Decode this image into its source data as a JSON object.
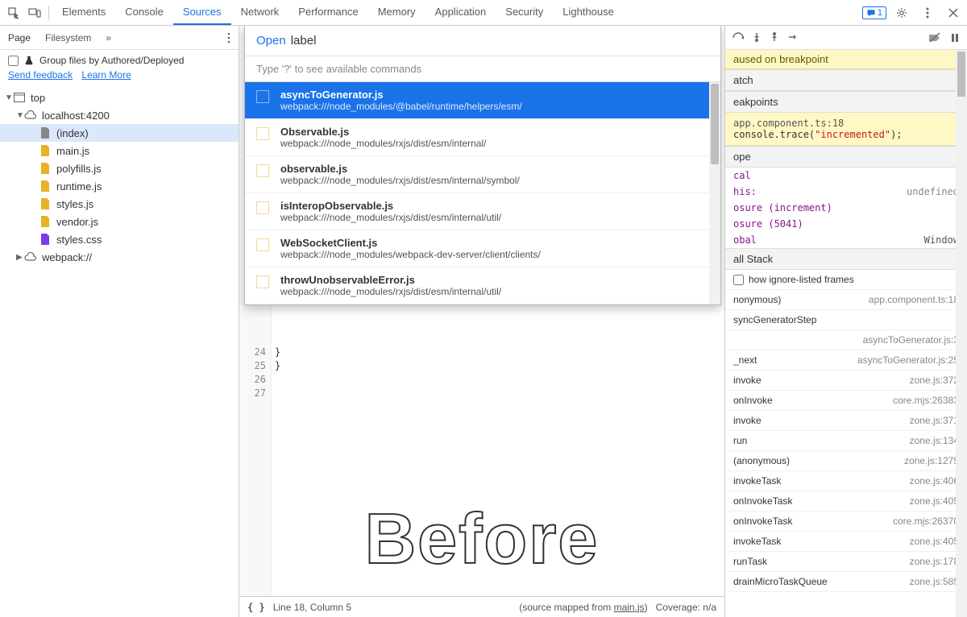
{
  "topTabs": [
    "Elements",
    "Console",
    "Sources",
    "Network",
    "Performance",
    "Memory",
    "Application",
    "Security",
    "Lighthouse"
  ],
  "topActiveIndex": 2,
  "msgCount": "1",
  "leftTabs": {
    "page": "Page",
    "filesystem": "Filesystem"
  },
  "leftHeader": {
    "group": "Group files by Authored/Deployed",
    "feedback": "Send feedback",
    "learn": "Learn More"
  },
  "tree": {
    "top": "top",
    "host": "localhost:4200",
    "files": [
      "(index)",
      "main.js",
      "polyfills.js",
      "runtime.js",
      "styles.js",
      "vendor.js",
      "styles.css"
    ],
    "webpack": "webpack://"
  },
  "commandMenu": {
    "open": "Open",
    "query": "label",
    "hint": "Type '?' to see available commands",
    "items": [
      {
        "title": "asyncToGenerator.js",
        "path": "webpack:///node_modules/@babel/runtime/helpers/esm/"
      },
      {
        "title": "Observable.js",
        "path": "webpack:///node_modules/rxjs/dist/esm/internal/"
      },
      {
        "title": "observable.js",
        "path": "webpack:///node_modules/rxjs/dist/esm/internal/symbol/"
      },
      {
        "title": "isInteropObservable.js",
        "path": "webpack:///node_modules/rxjs/dist/esm/internal/util/"
      },
      {
        "title": "WebSocketClient.js",
        "path": "webpack:///node_modules/webpack-dev-server/client/clients/"
      },
      {
        "title": "throwUnobservableError.js",
        "path": "webpack:///node_modules/rxjs/dist/esm/internal/util/"
      }
    ]
  },
  "codeGutter": [
    "24",
    "25",
    "26",
    "27"
  ],
  "codeLines": [
    "  }",
    "}",
    ""
  ],
  "statusBar": {
    "braces": "{ }",
    "pos": "Line 18, Column 5",
    "mapped": "(source mapped from ",
    "mapfile": "main.js",
    "mapend": ")",
    "coverage": "Coverage: n/a"
  },
  "overlay": "Before",
  "right": {
    "paused": "aused on breakpoint",
    "watch": "atch",
    "breakpoints": "eakpoints",
    "bpLoc": "app.component.ts:18",
    "bpCode1": "console.trace(",
    "bpStr": "\"incremented\"",
    "bpCode2": ");",
    "scope": "ope",
    "scopeRows": [
      {
        "k": "cal",
        "v": ""
      },
      {
        "k": "his:",
        "v": "undefined"
      },
      {
        "k": "osure (increment)",
        "v": ""
      },
      {
        "k": "osure (5041)",
        "v": ""
      },
      {
        "k": "obal",
        "v": "Window"
      }
    ],
    "callstack": "all Stack",
    "showIgnore": "how ignore-listed frames",
    "stack": [
      {
        "fn": "nonymous)",
        "loc": "app.component.ts:18"
      },
      {
        "fn": "syncGeneratorStep",
        "loc": ""
      },
      {
        "fn": "",
        "loc": "asyncToGenerator.js:3"
      },
      {
        "fn": "_next",
        "loc": "asyncToGenerator.js:25"
      },
      {
        "fn": "invoke",
        "loc": "zone.js:372"
      },
      {
        "fn": "onInvoke",
        "loc": "core.mjs:26383"
      },
      {
        "fn": "invoke",
        "loc": "zone.js:371"
      },
      {
        "fn": "run",
        "loc": "zone.js:134"
      },
      {
        "fn": "(anonymous)",
        "loc": "zone.js:1275"
      },
      {
        "fn": "invokeTask",
        "loc": "zone.js:406"
      },
      {
        "fn": "onInvokeTask",
        "loc": "zone.js:405"
      },
      {
        "fn": "onInvokeTask",
        "loc": "core.mjs:26370"
      },
      {
        "fn": "invokeTask",
        "loc": "zone.js:405"
      },
      {
        "fn": "runTask",
        "loc": "zone.js:178"
      },
      {
        "fn": "drainMicroTaskQueue",
        "loc": "zone.js:585"
      }
    ]
  }
}
